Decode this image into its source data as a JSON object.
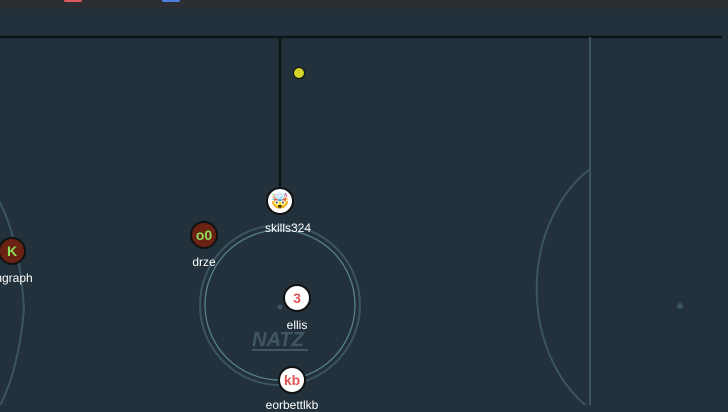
{
  "game": {
    "team_colors": {
      "red": "#e05656",
      "blue": "#4d7fe0",
      "brown": "#6a2312"
    },
    "field_color": "#22313b",
    "line_color": "#3b5562",
    "ball_color": "#d6d62a"
  },
  "players": [
    {
      "id": "skills324",
      "name": "skills324",
      "avatar": "🤯",
      "team": "red"
    },
    {
      "id": "drze",
      "name": "drze",
      "avatar": "o0",
      "team": "brown"
    },
    {
      "id": "ngraph",
      "name": "ngraph",
      "avatar": "K",
      "team": "brown"
    },
    {
      "id": "ellis",
      "name": "ellis",
      "avatar": "3",
      "team": "red"
    },
    {
      "id": "kb",
      "name": "eorbettlkb",
      "avatar": "kb",
      "team": "red"
    }
  ],
  "center_logo": "NATZ"
}
